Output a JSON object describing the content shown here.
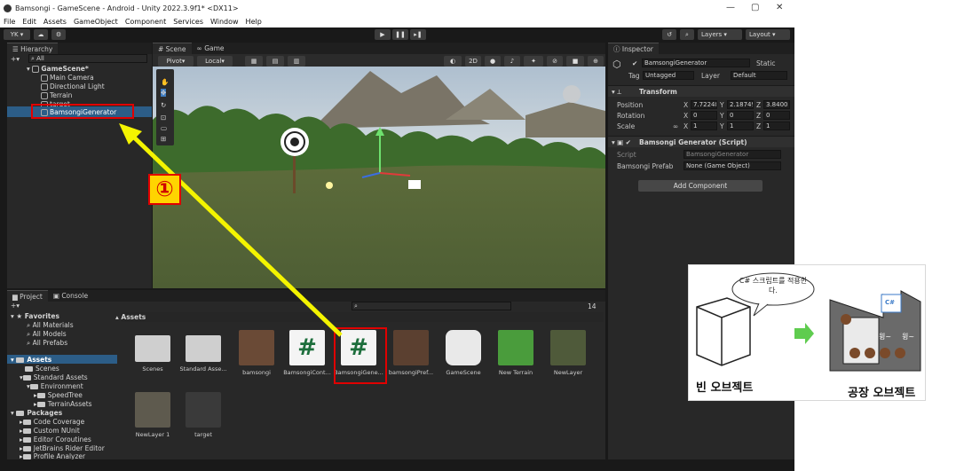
{
  "window": {
    "title": "Bamsongi - GameScene - Android - Unity 2022.3.9f1* <DX11>",
    "menu": [
      "File",
      "Edit",
      "Assets",
      "GameObject",
      "Component",
      "Services",
      "Window",
      "Help"
    ],
    "min": "—",
    "max": "▢",
    "close": "✕"
  },
  "toolbar": {
    "account": "YK ▾",
    "layers": "Layers",
    "layout": "Layout"
  },
  "hierarchy": {
    "tab": "Hierarchy",
    "search": "All",
    "scene": "GameScene*",
    "items": [
      "Main Camera",
      "Directional Light",
      "Terrain",
      "target",
      "BamsongiGenerator"
    ]
  },
  "scene_view": {
    "tab_scene": "Scene",
    "tab_game": "Game",
    "pivot": "Pivot",
    "local": "Local",
    "mode2d": "2D"
  },
  "inspector": {
    "tab": "Inspector",
    "object_name": "BamsongiGenerator",
    "static": "Static",
    "tag_label": "Tag",
    "tag_value": "Untagged",
    "layer_label": "Layer",
    "layer_value": "Default",
    "transform": {
      "title": "Transform",
      "position_label": "Position",
      "rotation_label": "Rotation",
      "scale_label": "Scale",
      "pos": [
        "7.72248",
        "2.18749",
        "3.8400"
      ],
      "rot": [
        "0",
        "0",
        "0"
      ],
      "scl": [
        "1",
        "1",
        "1"
      ]
    },
    "script": {
      "title": "Bamsongi Generator (Script)",
      "script_label": "Script",
      "script_value": "BamsongiGenerator",
      "prefab_label": "Bamsongi Prefab",
      "prefab_value": "None (Game Object)"
    },
    "add_component": "Add Component"
  },
  "project": {
    "tab_project": "Project",
    "tab_console": "Console",
    "count": "14",
    "favorites_title": "Favorites",
    "favorites": [
      "All Materials",
      "All Models",
      "All Prefabs"
    ],
    "assets_title": "Assets",
    "tree": [
      "Scenes",
      "Standard Assets",
      "Environment",
      "SpeedTree",
      "TerrainAssets"
    ],
    "packages_title": "Packages",
    "packages": [
      "Code Coverage",
      "Custom NUnit",
      "Editor Coroutines",
      "JetBrains Rider Editor",
      "Profile Analyzer"
    ],
    "breadcrumb": "Assets",
    "assets": [
      "Scenes",
      "Standard Asse...",
      "bamsongi",
      "BamsongiCont...",
      "BamsongiGene...",
      "bamsongiPref...",
      "GameScene",
      "New Terrain",
      "NewLayer",
      "NewLayer 1",
      "target"
    ]
  },
  "annotation": {
    "marker": "①",
    "bubble": "C# 스크립트를 적용한다.",
    "empty_label": "빈 오브젝트",
    "factory_label": "공장 오브젝트",
    "cs_text": "C#",
    "sound1": "윙~",
    "sound2": "윙~",
    "colors": {
      "highlight": "#e00000",
      "arrow": "#f4f400",
      "marker_bg": "#ffd400"
    }
  }
}
